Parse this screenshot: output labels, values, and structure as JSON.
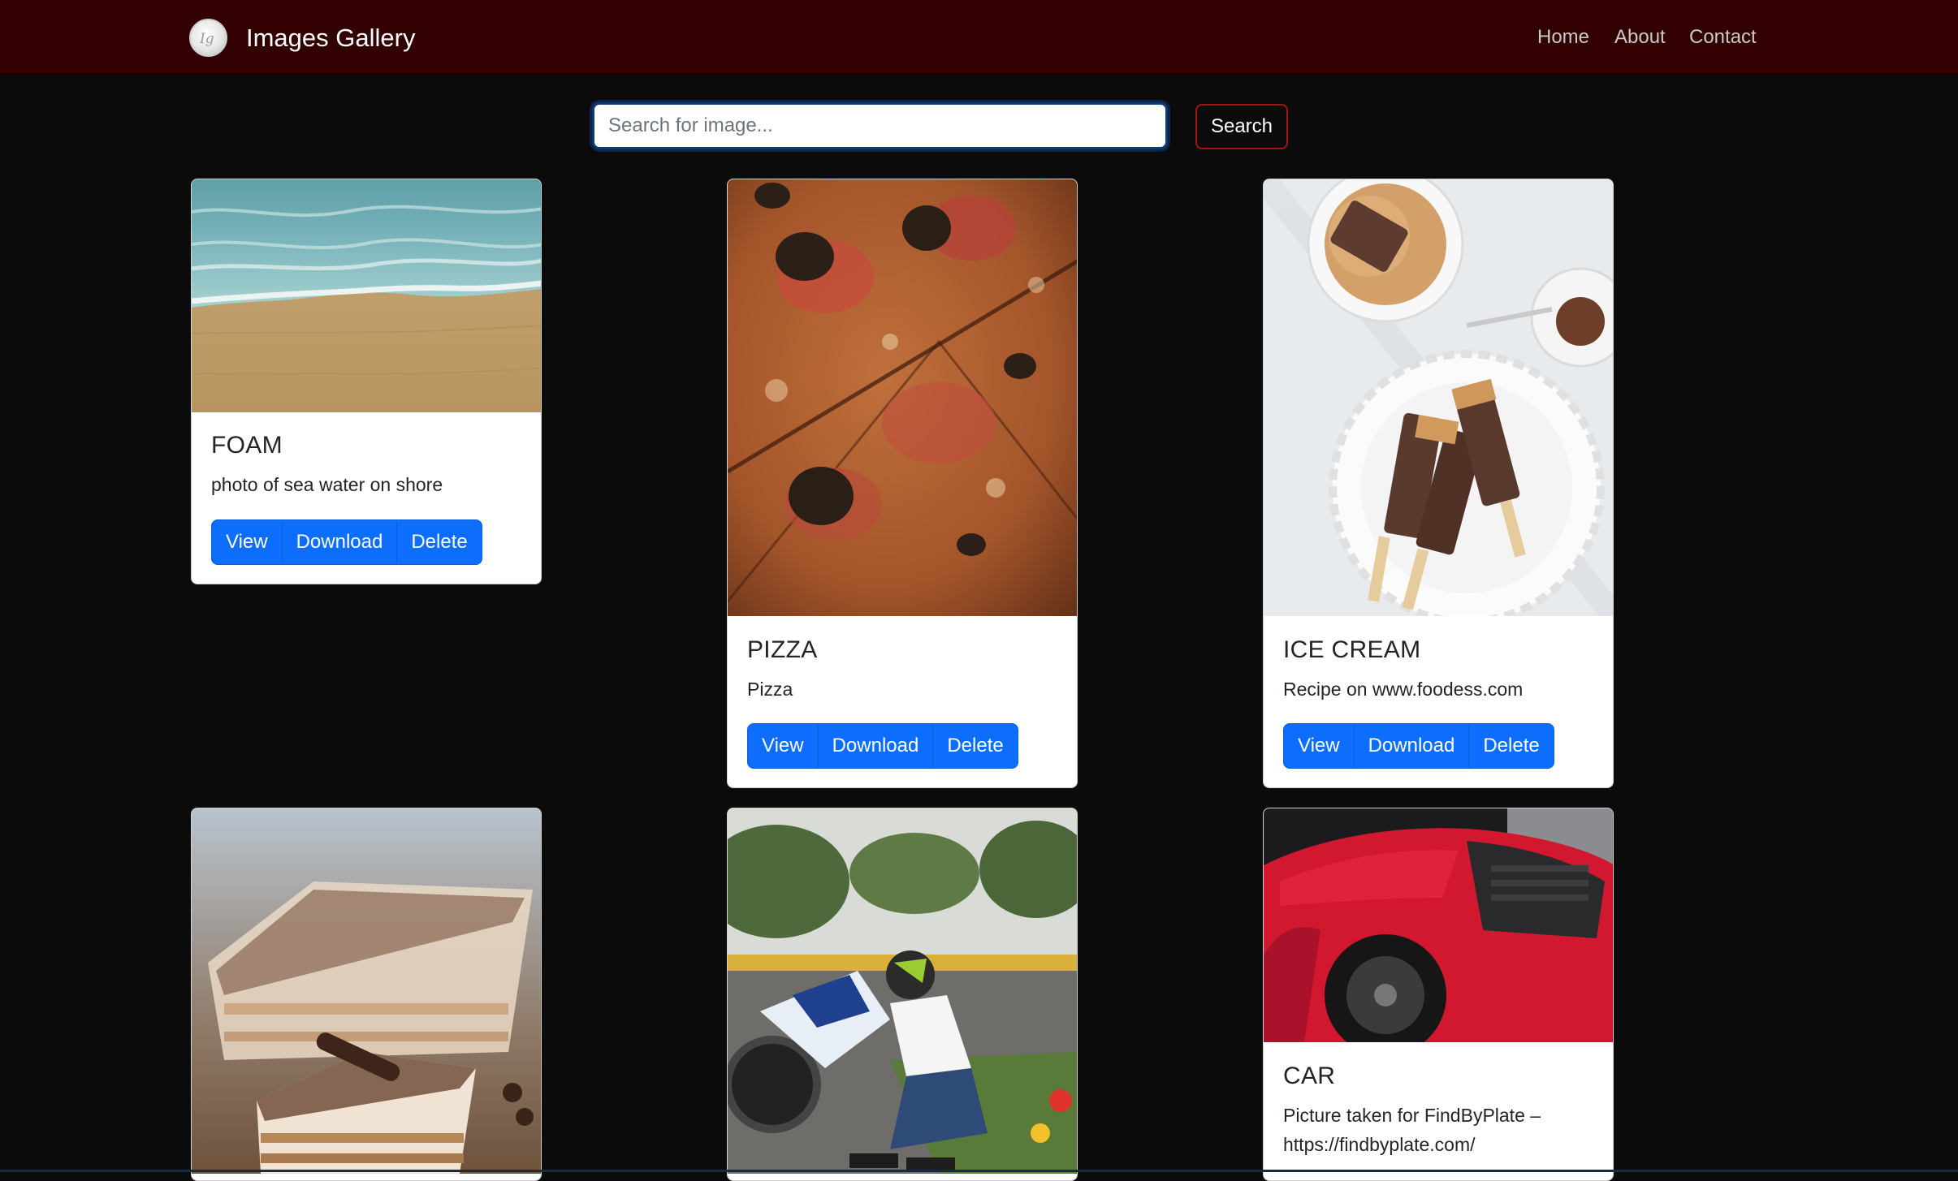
{
  "navbar": {
    "brand_title": "Images Gallery",
    "brand_logo_icon": "gallery-logo-icon",
    "links": [
      "Home",
      "About",
      "Contact"
    ],
    "background": "#330000"
  },
  "search": {
    "placeholder": "Search for image...",
    "value": "",
    "button_label": "Search"
  },
  "cards": [
    {
      "title": "FOAM",
      "description": "photo of sea water on shore",
      "image": "sea-shore-photo",
      "buttons": {
        "view": "View",
        "download": "Download",
        "delete": "Delete"
      }
    },
    {
      "title": "PIZZA",
      "description": "Pizza",
      "image": "pizza-photo",
      "buttons": {
        "view": "View",
        "download": "Download",
        "delete": "Delete"
      }
    },
    {
      "title": "ICE CREAM",
      "description": "Recipe on www.foodess.com",
      "image": "ice-cream-photo",
      "buttons": {
        "view": "View",
        "download": "Download",
        "delete": "Delete"
      }
    },
    {
      "title": "",
      "description": "",
      "image": "cake-photo"
    },
    {
      "title": "",
      "description": "",
      "image": "motorcycle-rider-photo"
    },
    {
      "title": "CAR",
      "description": "Picture taken for FindByPlate – https://findbyplate.com/",
      "image": "red-sports-car-photo"
    }
  ],
  "colors": {
    "page_background": "#0b0b0b",
    "primary_button": "#0d6efd",
    "search_button_border": "#a01414"
  }
}
